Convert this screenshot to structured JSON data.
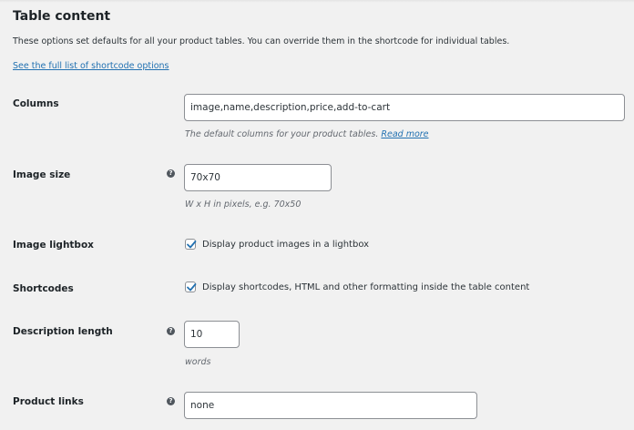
{
  "section": {
    "title": "Table content",
    "description": "These options set defaults for all your product tables. You can override them in the shortcode for individual tables.",
    "link_text": "See the full list of shortcode options"
  },
  "fields": {
    "columns": {
      "label": "Columns",
      "value": "image,name,description,price,add-to-cart",
      "description": "The default columns for your product tables.",
      "read_more": "Read more"
    },
    "image_size": {
      "label": "Image size",
      "value": "70x70",
      "description": "W x H in pixels, e.g. 70x50"
    },
    "image_lightbox": {
      "label": "Image lightbox",
      "checkbox_label": "Display product images in a lightbox",
      "checked": true
    },
    "shortcodes": {
      "label": "Shortcodes",
      "checkbox_label": "Display shortcodes, HTML and other formatting inside the table content",
      "checked": true
    },
    "description_length": {
      "label": "Description length",
      "value": "10",
      "description": "words"
    },
    "product_links": {
      "label": "Product links",
      "value": "none"
    }
  },
  "icons": {
    "help": "help-icon",
    "checkmark": "checkmark-icon"
  },
  "colors": {
    "background": "#f1f1f1",
    "link": "#2271b1",
    "checkmark": "#2271b1",
    "help_icon": "#50575e"
  }
}
